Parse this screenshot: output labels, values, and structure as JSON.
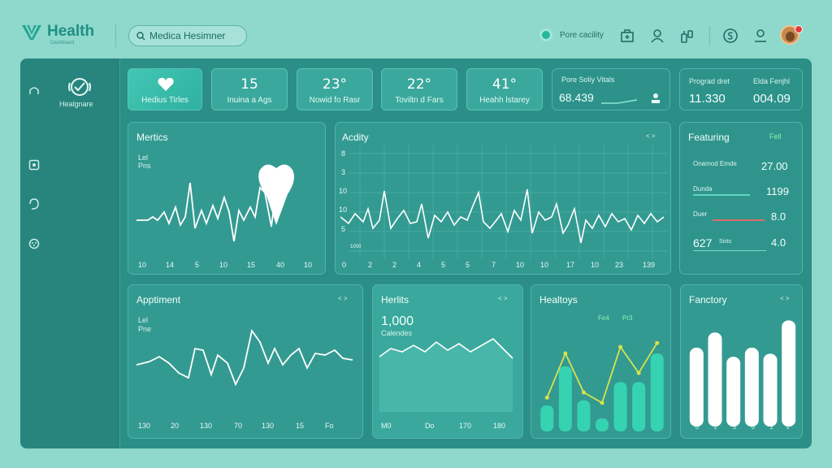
{
  "header": {
    "brand": "Health",
    "brand_sub": "Dashboard",
    "search_placeholder": "Medica Hesimner",
    "status": "Pore cacility"
  },
  "sidebar": {
    "logo_label": "Healgnare"
  },
  "tiles": [
    {
      "big": "",
      "small": "Hedius Tirles",
      "icon": "heart-icon"
    },
    {
      "big": "15",
      "small": "Inuina a Ags"
    },
    {
      "big": "23°",
      "small": "Nowid fo Rasr"
    },
    {
      "big": "22°",
      "small": "Toviltn d Fars"
    },
    {
      "big": "41°",
      "small": "Heahh lstarey"
    }
  ],
  "vitals": {
    "title": "Pore Soliy Vitals",
    "value": "68.439"
  },
  "stats": {
    "label_a": "Prograd dret",
    "label_b": "Elda Fenjhl",
    "value_a": "11.330",
    "value_b": "004.09"
  },
  "cards": {
    "metrics": {
      "title": "Mertics",
      "axis_l1": "Lel",
      "axis_l2": "Pns",
      "xticks": [
        "10",
        "14",
        "5",
        "10",
        "15",
        "40",
        "10"
      ]
    },
    "activity": {
      "title": "Acdity",
      "ctl": "< >",
      "yticks": [
        "8",
        "3",
        "10",
        "10",
        "5"
      ],
      "xticks": [
        "0",
        "2",
        "2",
        "4",
        "5",
        "5",
        "7",
        "10",
        "10",
        "17",
        "10",
        "23",
        "139"
      ],
      "sub": "1000"
    },
    "featuring": {
      "title": "Featuring",
      "ctl": "Fell",
      "rows": [
        {
          "label": "Onamod Emde",
          "value": "27.00"
        },
        {
          "label": "Dunda",
          "value": "1199"
        },
        {
          "label": "Duer",
          "value": "8.0"
        },
        {
          "label": "Sists",
          "lead": "627",
          "value": "4.0"
        }
      ]
    },
    "appointment": {
      "title": "Apptiment",
      "ctl": "< >",
      "axis_l1": "Lel",
      "axis_l2": "Pne",
      "xticks": [
        "130",
        "20",
        "130",
        "70",
        "130",
        "15",
        "Fo"
      ]
    },
    "heritis": {
      "title": "Herlits",
      "ctl": "< >",
      "value": "1,000",
      "sub": "Calendes",
      "xticks": [
        "M0",
        "Do",
        "170",
        "180"
      ]
    },
    "healtoys": {
      "title": "Healtoys",
      "legend_a": "Fe4",
      "legend_b": "Pr3"
    },
    "fanctory": {
      "title": "Fanctory",
      "ctl": "< >",
      "xticks": [
        "o",
        "z",
        "5",
        "o",
        "z",
        "s"
      ]
    }
  },
  "chart_data": [
    {
      "type": "bar",
      "title": "Healtoys",
      "values": [
        2,
        5,
        2.4,
        1,
        3.8,
        3.8,
        6
      ],
      "line": [
        2.6,
        6,
        3,
        2.2,
        6.5,
        4.5,
        6.8
      ],
      "ylim": [
        0,
        7
      ]
    },
    {
      "type": "bar",
      "title": "Fanctory",
      "values": [
        5.2,
        6.2,
        4.6,
        5.2,
        4.8,
        7
      ],
      "ylim": [
        0,
        7.5
      ]
    }
  ],
  "colors": {
    "bar_green": "#35d3b2",
    "bar_white": "#ffffff",
    "line_yellow": "#d7e34a",
    "accent": "#2fb0a0"
  }
}
